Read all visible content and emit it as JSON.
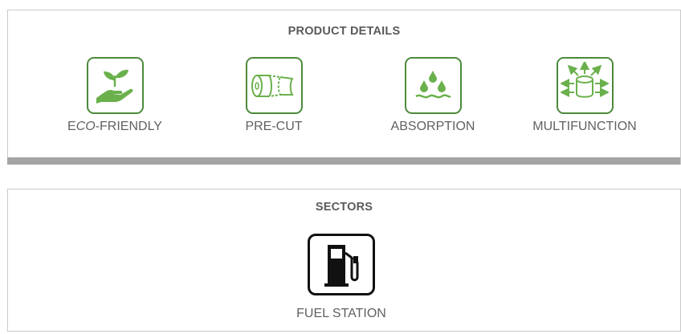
{
  "product_details": {
    "title": "PRODUCT DETAILS",
    "items": [
      {
        "label_prefix": "E",
        "label_italic": "CO",
        "label_suffix": "-FRIENDLY",
        "icon": "plant-hand-icon"
      },
      {
        "label": "PRE-CUT",
        "icon": "paper-roll-icon"
      },
      {
        "label": "ABSORPTION",
        "icon": "water-drops-icon"
      },
      {
        "label": "MULTIFUNCTION",
        "icon": "roll-arrows-icon"
      }
    ]
  },
  "sectors": {
    "title": "SECTORS",
    "items": [
      {
        "label": "FUEL STATION",
        "icon": "fuel-pump-icon"
      }
    ]
  },
  "colors": {
    "accent_green": "#4c8a3b",
    "icon_green": "#6ab04c",
    "border_gray": "#c9c9c9",
    "bar_gray": "#a4a4a4"
  }
}
